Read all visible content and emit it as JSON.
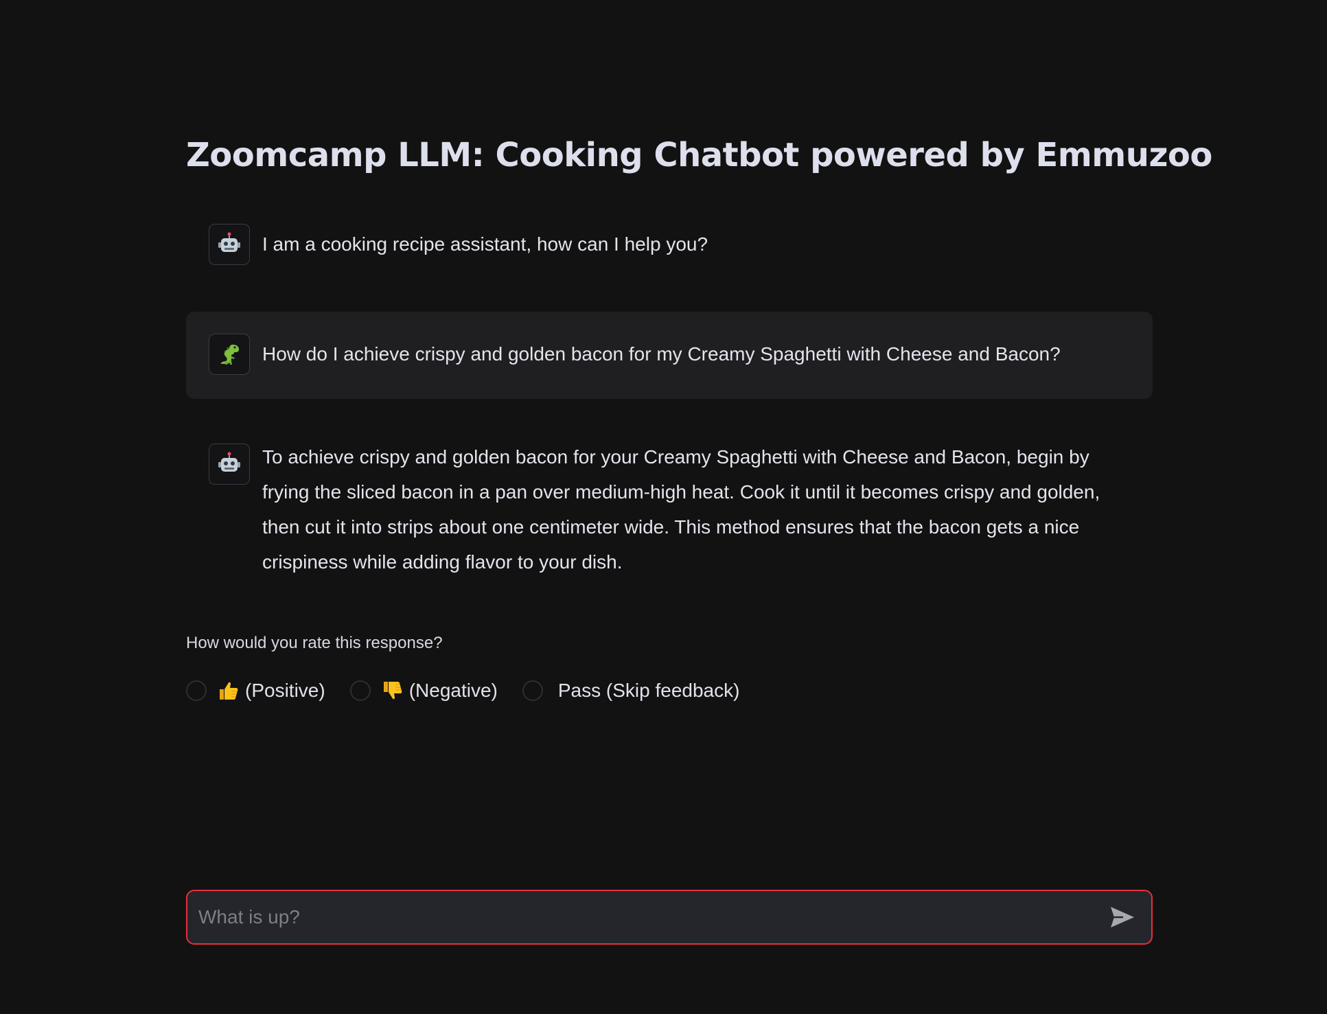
{
  "app": {
    "title": "Zoomcamp LLM: Cooking Chatbot powered by Emmuzoo"
  },
  "messages": [
    {
      "role": "assistant",
      "avatar_icon": "robot-icon",
      "text": "I am a cooking recipe assistant, how can I help you?"
    },
    {
      "role": "user",
      "avatar_icon": "dinosaur-icon",
      "text": "How do I achieve crispy and golden bacon for my Creamy Spaghetti with Cheese and Bacon?"
    },
    {
      "role": "assistant",
      "avatar_icon": "robot-icon",
      "text": "To achieve crispy and golden bacon for your Creamy Spaghetti with Cheese and Bacon, begin by frying the sliced bacon in a pan over medium-high heat. Cook it until it becomes crispy and golden, then cut it into strips about one centimeter wide. This method ensures that the bacon gets a nice crispiness while adding flavor to your dish."
    }
  ],
  "feedback": {
    "question": "How would you rate this response?",
    "options": [
      {
        "icon": "thumbs-up-icon",
        "label": "(Positive)"
      },
      {
        "icon": "thumbs-down-icon",
        "label": "(Negative)"
      },
      {
        "icon": "",
        "label": "Pass (Skip feedback)"
      }
    ]
  },
  "chat_input": {
    "placeholder": "What is up?",
    "value": "",
    "send_icon": "send-icon"
  },
  "colors": {
    "background": "#121213",
    "user_bubble": "#1f1f22",
    "input_border_focus": "#e5303d",
    "input_background": "#25262b"
  }
}
